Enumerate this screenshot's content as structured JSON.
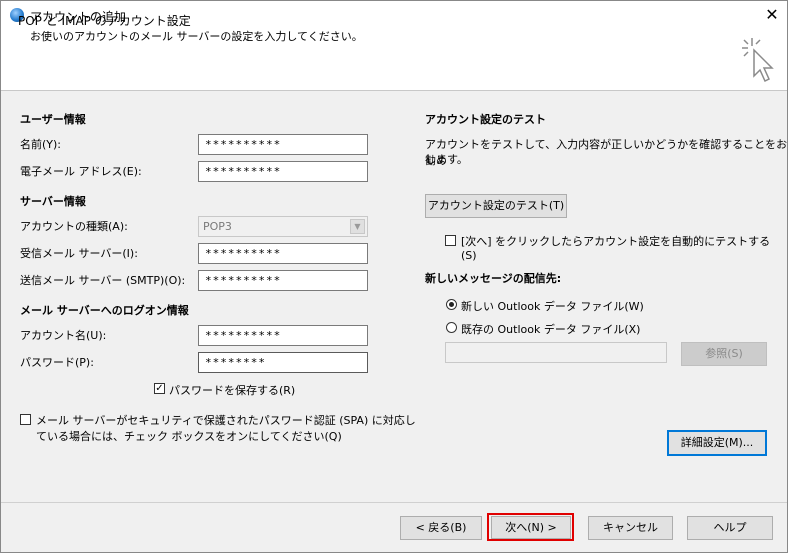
{
  "window": {
    "title": "アカウントの追加",
    "close_glyph": "✕"
  },
  "header": {
    "title": "POP と IMAP のアカウント設定",
    "subtitle": "お使いのアカウントのメール サーバーの設定を入力してください。"
  },
  "user_info": {
    "heading": "ユーザー情報",
    "name_label": "名前(Y):",
    "name_value": "**********",
    "email_label": "電子メール アドレス(E):",
    "email_value": "**********"
  },
  "server_info": {
    "heading": "サーバー情報",
    "account_type_label": "アカウントの種類(A):",
    "account_type_value": "POP3",
    "incoming_label": "受信メール サーバー(I):",
    "incoming_value": "**********",
    "outgoing_label": "送信メール サーバー (SMTP)(O):",
    "outgoing_value": "**********"
  },
  "logon_info": {
    "heading": "メール サーバーへのログオン情報",
    "account_name_label": "アカウント名(U):",
    "account_name_value": "**********",
    "password_label": "パスワード(P):",
    "password_value": "********",
    "save_password_label": "パスワードを保存する(R)",
    "save_password_checked": true,
    "spa_label_line1": "メール サーバーがセキュリティで保護されたパスワード認証 (SPA) に対応し",
    "spa_label_line2": "ている場合には、チェック ボックスをオンにしてください(Q)",
    "spa_checked": false
  },
  "test": {
    "heading": "アカウント設定のテスト",
    "description_line1": "アカウントをテストして、入力内容が正しいかどうかを確認することをお勧め",
    "description_line2": "します。",
    "test_button": "アカウント設定のテスト(T)",
    "auto_test_label_line1": "[次へ] をクリックしたらアカウント設定を自動的にテストする",
    "auto_test_label_line2": "(S)",
    "auto_test_checked": false
  },
  "delivery": {
    "heading": "新しいメッセージの配信先:",
    "new_file_label": "新しい Outlook データ ファイル(W)",
    "existing_file_label": "既存の Outlook データ ファイル(X)",
    "selected": "new",
    "path_value": "",
    "browse_button": "参照(S)"
  },
  "more_settings_button": "詳細設定(M)...",
  "footer": {
    "back_button": "< 戻る(B)",
    "next_button": "次へ(N) >",
    "cancel_button": "キャンセル",
    "help_button": "ヘルプ"
  },
  "colors": {
    "highlight": "#e00000",
    "focus": "#0078d7"
  },
  "icons": {
    "app": "outlook-globe-icon",
    "wizard": "sparkle-cursor-icon",
    "check": "✓"
  }
}
